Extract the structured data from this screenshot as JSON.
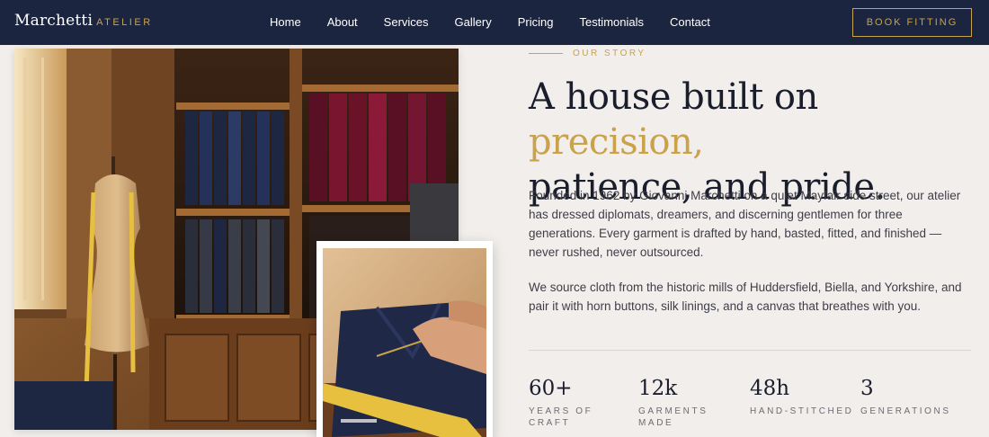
{
  "brand": {
    "name": "Marchetti",
    "sub": "ATELIER"
  },
  "nav": {
    "items": [
      "Home",
      "About",
      "Services",
      "Gallery",
      "Pricing",
      "Testimonials",
      "Contact"
    ],
    "cta": "BOOK FITTING"
  },
  "images": {
    "main": "atelier-interior-photo",
    "detail": "hand-stitching-photo"
  },
  "story": {
    "eyebrow": "OUR STORY",
    "headline_1": "A house built on ",
    "headline_accent": "precision,",
    "headline_2": "patience, and pride.",
    "para1": "Founded in 1962 by Giovanni Marchetti on a quiet Mayfair side street, our atelier has dressed diplomats, dreamers, and discerning gentlemen for three generations. Every garment is drafted by hand, basted, fitted, and finished — never rushed, never outsourced.",
    "para2": "We source cloth from the historic mills of Huddersfield, Biella, and Yorkshire, and pair it with horn buttons, silk linings, and a canvas that breathes with you."
  },
  "stats": [
    {
      "value": "60+",
      "label": "YEARS OF\nCRAFT"
    },
    {
      "value": "12k",
      "label": "GARMENTS\nMADE"
    },
    {
      "value": "48h",
      "label": "HAND-STITCHED"
    },
    {
      "value": "3",
      "label": "GENERATIONS"
    }
  ],
  "colors": {
    "navy": "#1b2540",
    "gold": "#c9a24a",
    "background": "#f1eeeb"
  }
}
